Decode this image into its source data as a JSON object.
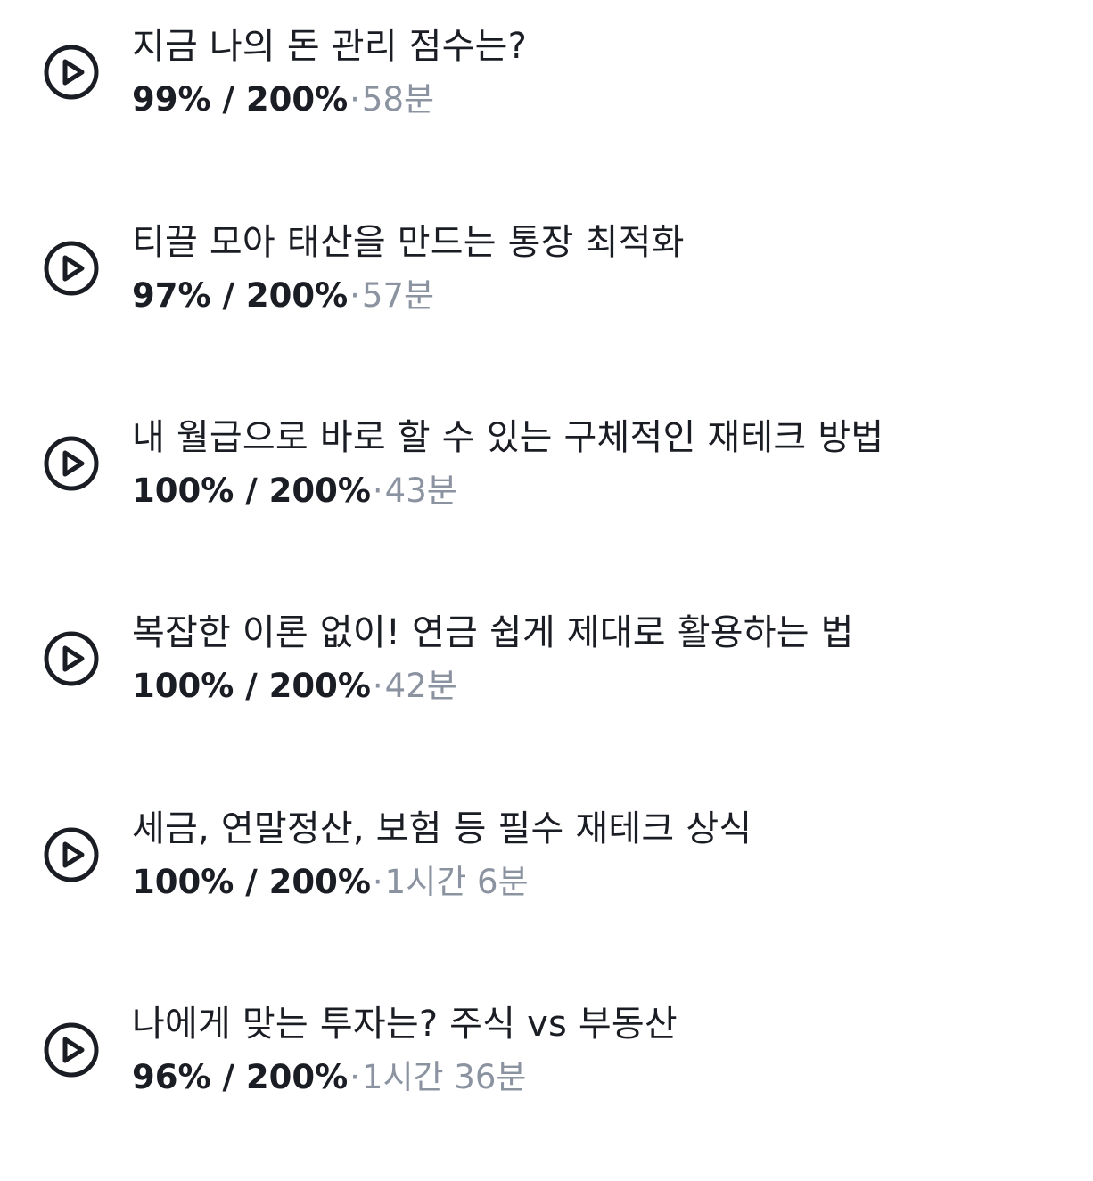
{
  "lessons": [
    {
      "title": "지금 나의 돈 관리 점수는?",
      "progress": "99% / 200%",
      "separator": "·",
      "duration": "58분",
      "icon": "play-circle-icon"
    },
    {
      "title": "티끌 모아 태산을 만드는 통장 최적화",
      "progress": "97% / 200%",
      "separator": "·",
      "duration": "57분",
      "icon": "play-circle-icon"
    },
    {
      "title": "내 월급으로 바로 할 수 있는 구체적인 재테크 방법",
      "progress": "100% / 200%",
      "separator": "·",
      "duration": "43분",
      "icon": "play-circle-icon"
    },
    {
      "title": "복잡한 이론 없이! 연금 쉽게 제대로 활용하는 법",
      "progress": "100% / 200%",
      "separator": "·",
      "duration": "42분",
      "icon": "play-circle-icon"
    },
    {
      "title": "세금, 연말정산, 보험 등 필수 재테크 상식",
      "progress": "100% / 200%",
      "separator": "·",
      "duration": "1시간 6분",
      "icon": "play-circle-icon"
    },
    {
      "title": "나에게 맞는 투자는? 주식 vs 부동산",
      "progress": "96% / 200%",
      "separator": "·",
      "duration": "1시간 36분",
      "icon": "play-circle-icon"
    }
  ],
  "colors": {
    "text_primary": "#1b1d24",
    "text_secondary": "#8b93a1",
    "background": "#ffffff"
  }
}
